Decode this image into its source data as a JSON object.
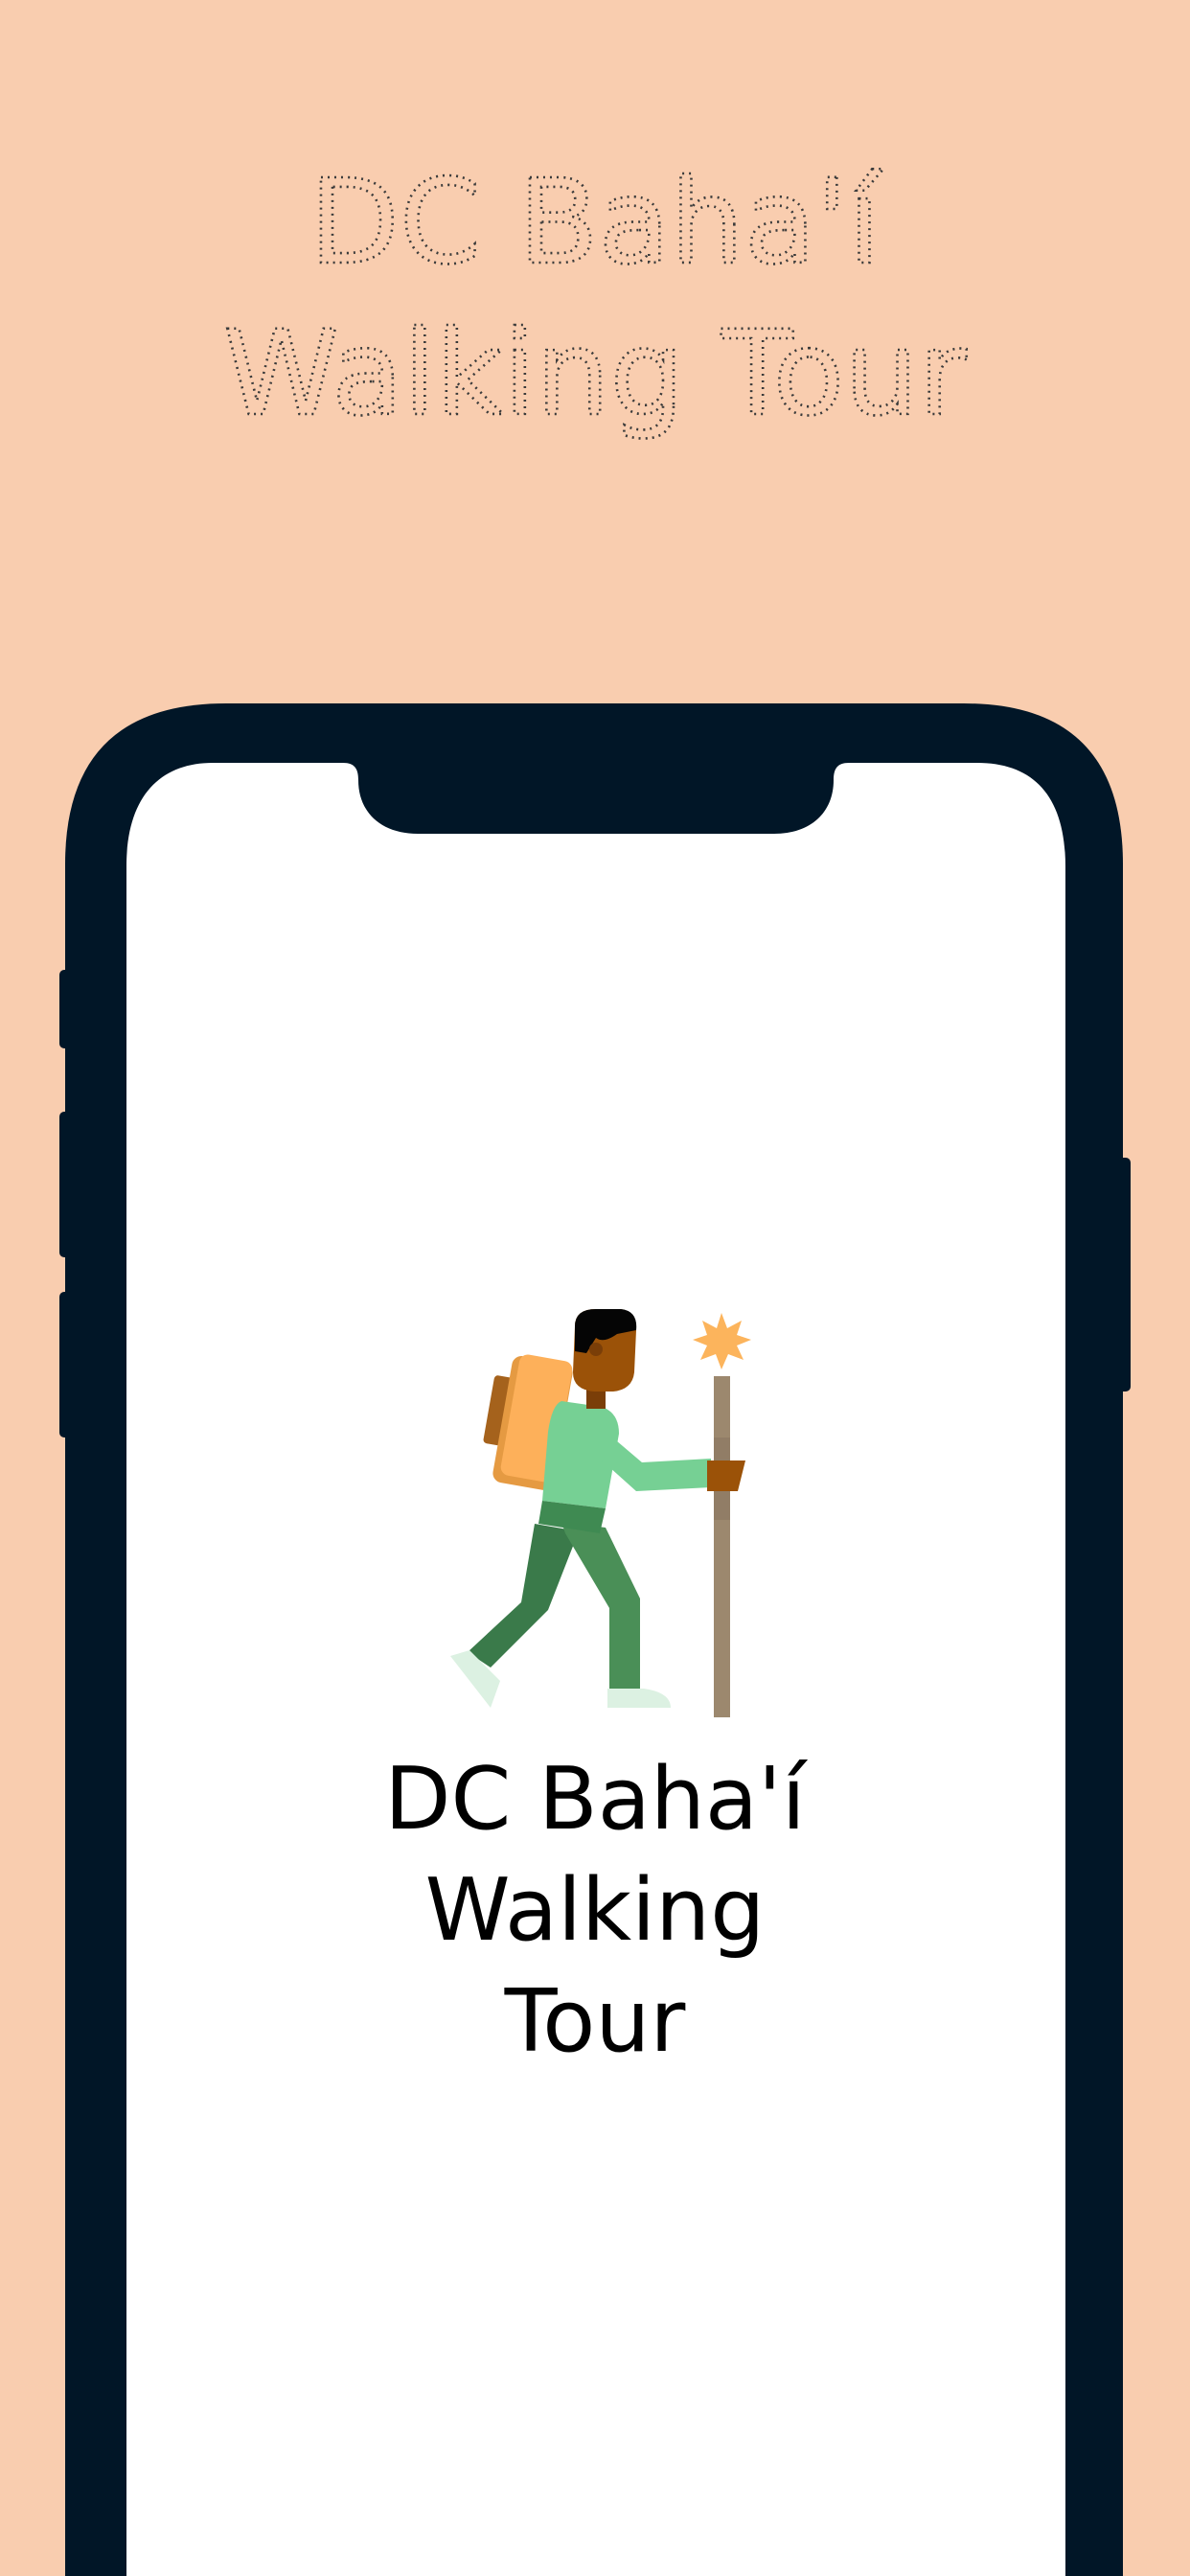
{
  "promo": {
    "heading_line1": "DC Baha'í",
    "heading_line2": "Walking Tour"
  },
  "splash": {
    "title_line1": "DC Baha'í",
    "title_line2": "Walking",
    "title_line3": "Tour"
  },
  "colors": {
    "background": "#F9CDAF",
    "device_frame": "#011627",
    "screen": "#FFFFFF",
    "heading_stroke": "#3A3A3A",
    "hiker_shirt": "#76D094",
    "hiker_pants": "#4A8F57",
    "backpack": "#FDB05A",
    "staff": "#9C886E",
    "star": "#FCB45C",
    "skin": "#9B5208"
  },
  "icons": {
    "illustration": "hiker-with-staff-illustration",
    "star": "star-icon"
  }
}
